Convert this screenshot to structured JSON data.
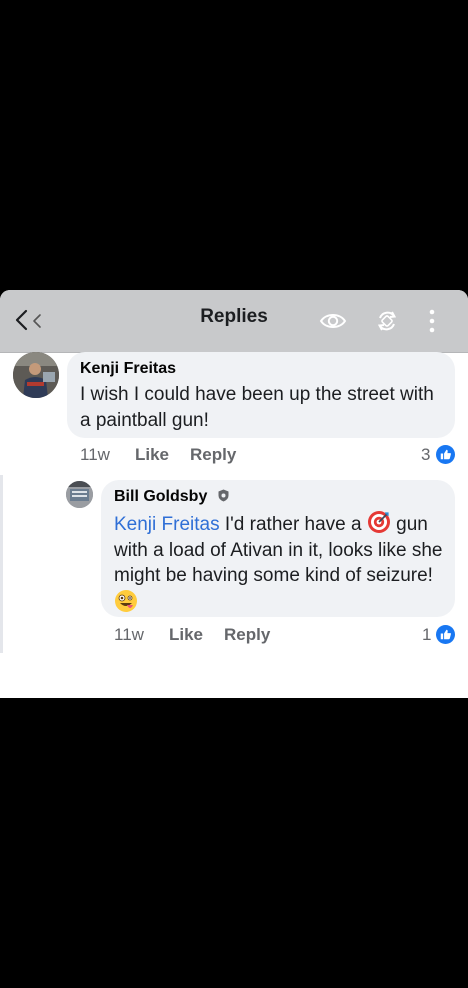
{
  "header": {
    "title": "Replies",
    "back_icon": "back-arrow-icon",
    "eye_icon": "eye-icon",
    "sync_icon": "sync-icon",
    "more_icon": "more-vertical-icon"
  },
  "comments": [
    {
      "author": "Kenji Freitas",
      "text": "I wish I could have been up the street with a paintball gun!",
      "time": "11w",
      "like_label": "Like",
      "reply_label": "Reply",
      "reaction_count": "3"
    }
  ],
  "reply": {
    "author": "Bill Goldsby",
    "mention": "Kenji Freitas",
    "text_part1": " I'd rather have a ",
    "text_part2": " gun with a load of Ativan in it, looks like she might be having some kind of seizure!",
    "time": "11w",
    "like_label": "Like",
    "reply_label": "Reply",
    "reaction_count": "1"
  },
  "colors": {
    "header_bg": "#c8c9cb",
    "bubble_bg": "#f0f2f5",
    "mention": "#2f6fd6",
    "like_blue": "#1877f2"
  }
}
